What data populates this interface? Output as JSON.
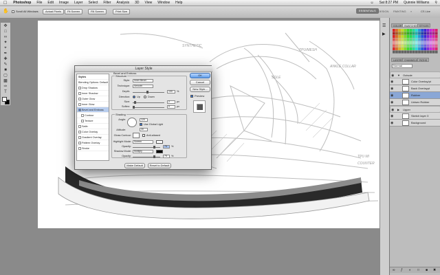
{
  "menubar": {
    "items": [
      "Photoshop",
      "File",
      "Edit",
      "Image",
      "Layer",
      "Select",
      "Filter",
      "Analysis",
      "3D",
      "View",
      "Window",
      "Help"
    ],
    "time": "Sat 8:27 PM",
    "user": "Quinnie Williams"
  },
  "options": {
    "scroll_all_windows": "Scroll All Windows",
    "actual_pixels": "Actual Pixels",
    "fit_screen": "Fit Screen",
    "fill_screen": "Fill Screen",
    "print_size": "Print Size"
  },
  "workspace": {
    "essentials": "ESSENTIALS",
    "design": "DESIGN",
    "painting": "PAINTING",
    "cs_live": "CS Live"
  },
  "panels": {
    "tabs_top": [
      "COLOR",
      "SWATCHES",
      "STYLES"
    ],
    "tabs_layers": [
      "LAYERS",
      "CHANNELS",
      "PATHS"
    ],
    "blend_mode": "Normal",
    "layers": [
      {
        "name": "Outsole",
        "group": true
      },
      {
        "name": "Color Overlay/pt",
        "group": false
      },
      {
        "name": "Back Overlaypt",
        "group": false
      },
      {
        "name": "Rubber",
        "group": false,
        "selected": true
      },
      {
        "name": "Unisex Rubber",
        "group": false
      },
      {
        "name": "Upper",
        "group": true
      },
      {
        "name": "Sketch layer 3",
        "group": false
      },
      {
        "name": "Background",
        "group": false
      }
    ]
  },
  "sketch": {
    "label_1": "SYNTHETIC",
    "label_2": "TPU/MESH",
    "label_3": "SOLE",
    "label_4": "ANKLE COLLAR",
    "label_5": "TPU MI",
    "label_6": "COUNTER"
  },
  "dialog": {
    "title": "Layer Style",
    "styles_header": "Styles",
    "blending": "Blending Options: Default",
    "styles": [
      {
        "label": "Drop Shadow",
        "checked": false
      },
      {
        "label": "Inner Shadow",
        "checked": false
      },
      {
        "label": "Outer Glow",
        "checked": false
      },
      {
        "label": "Inner Glow",
        "checked": false
      },
      {
        "label": "Bevel and Emboss",
        "checked": true,
        "selected": true
      },
      {
        "label": "Contour",
        "checked": false,
        "sub": true
      },
      {
        "label": "Texture",
        "checked": false,
        "sub": true
      },
      {
        "label": "Satin",
        "checked": false
      },
      {
        "label": "Color Overlay",
        "checked": false
      },
      {
        "label": "Gradient Overlay",
        "checked": false
      },
      {
        "label": "Pattern Overlay",
        "checked": false
      },
      {
        "label": "Stroke",
        "checked": false
      }
    ],
    "bevel_title": "Bevel and Emboss",
    "structure_title": "Structure",
    "style_label": "Style:",
    "style_value": "Inner Bevel",
    "technique_label": "Technique:",
    "technique_value": "Smooth",
    "depth_label": "Depth:",
    "depth_value": "100",
    "direction_label": "Direction:",
    "dir_up": "Up",
    "dir_down": "Down",
    "size_label": "Size:",
    "size_value": "2",
    "soften_label": "Soften:",
    "soften_value": "0",
    "shading_title": "Shading",
    "angle_label": "Angle:",
    "angle_value": "120",
    "global_light": "Use Global Light",
    "altitude_label": "Altitude:",
    "altitude_value": "30",
    "gloss_label": "Gloss Contour:",
    "anti_aliased": "Anti-aliased",
    "highlight_label": "Highlight Mode:",
    "highlight_value": "Screen",
    "opacity_label": "Opacity:",
    "hl_opacity": "75",
    "shadow_label": "Shadow Mode:",
    "shadow_value": "Multiply",
    "sh_opacity": "75",
    "unit_pct": "%",
    "unit_px": "px",
    "make_default": "Make Default",
    "reset_default": "Reset to Default",
    "ok": "OK",
    "cancel": "Cancel",
    "new_style": "New Style...",
    "preview": "Preview"
  }
}
